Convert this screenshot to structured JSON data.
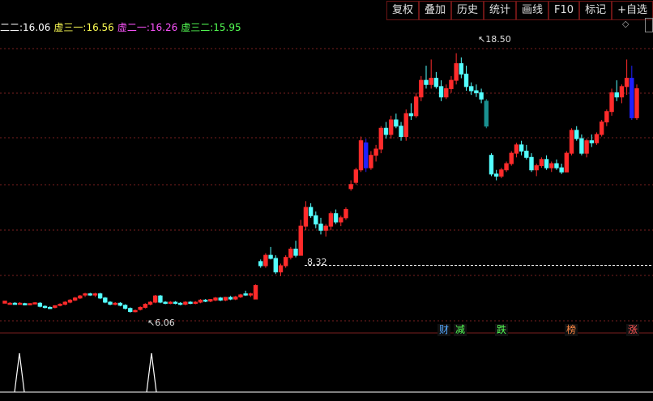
{
  "toolbar": {
    "buttons": [
      "复权",
      "叠加",
      "历史",
      "统计",
      "画线",
      "F10",
      "标记",
      "+自选"
    ]
  },
  "legend": {
    "items": [
      {
        "label": "二二:",
        "value": "16.06",
        "color": "#ffffff"
      },
      {
        "label": "虚三一:",
        "value": "16.56",
        "color": "#ffff54"
      },
      {
        "label": "虚二一:",
        "value": "16.26",
        "color": "#ff54ff"
      },
      {
        "label": "虚三二:",
        "value": "15.95",
        "color": "#54ff54"
      }
    ]
  },
  "icons": {
    "diamond": "diamond-icon"
  },
  "annotations": {
    "high": "18.50",
    "low": "6.06",
    "mid": "8.32"
  },
  "badges": [
    {
      "text": "财",
      "color": "#54a8ff"
    },
    {
      "text": "减",
      "color": "#54ff54"
    },
    {
      "text": "跌",
      "color": "#54ff54"
    },
    {
      "text": "榜",
      "color": "#ff8844"
    },
    {
      "text": "涨",
      "color": "#ff5454"
    }
  ],
  "chart_data": {
    "type": "candlestick",
    "colors": {
      "up": "#ff2b2b",
      "down": "#54ffff",
      "grid": "#7a1f1f",
      "blue": "#2020ff",
      "teal": "#1a9090"
    },
    "candles": [
      [
        6.5,
        6.6,
        6.5,
        6.6
      ],
      [
        6.5,
        6.55,
        6.45,
        6.5
      ],
      [
        6.5,
        6.55,
        6.45,
        6.48
      ],
      [
        6.5,
        6.55,
        6.45,
        6.5
      ],
      [
        6.48,
        6.52,
        6.4,
        6.45
      ],
      [
        6.45,
        6.5,
        6.4,
        6.48
      ],
      [
        6.5,
        6.55,
        6.45,
        6.52
      ],
      [
        6.5,
        6.55,
        6.3,
        6.35
      ],
      [
        6.35,
        6.4,
        6.25,
        6.3
      ],
      [
        6.3,
        6.35,
        6.25,
        6.28
      ],
      [
        6.3,
        6.4,
        6.25,
        6.38
      ],
      [
        6.4,
        6.5,
        6.35,
        6.45
      ],
      [
        6.45,
        6.6,
        6.4,
        6.55
      ],
      [
        6.55,
        6.7,
        6.5,
        6.65
      ],
      [
        6.65,
        6.8,
        6.6,
        6.75
      ],
      [
        6.75,
        6.9,
        6.7,
        6.85
      ],
      [
        6.9,
        7.0,
        6.8,
        6.95
      ],
      [
        6.95,
        7.0,
        6.85,
        6.9
      ],
      [
        6.9,
        7.0,
        6.8,
        6.95
      ],
      [
        6.95,
        7.0,
        6.7,
        6.75
      ],
      [
        6.75,
        6.8,
        6.5,
        6.55
      ],
      [
        6.55,
        6.6,
        6.4,
        6.45
      ],
      [
        6.45,
        6.55,
        6.4,
        6.5
      ],
      [
        6.5,
        6.55,
        6.35,
        6.4
      ],
      [
        6.4,
        6.45,
        6.2,
        6.25
      ],
      [
        6.25,
        6.3,
        6.05,
        6.1
      ],
      [
        6.1,
        6.2,
        6.06,
        6.15
      ],
      [
        6.2,
        6.35,
        6.15,
        6.3
      ],
      [
        6.3,
        6.5,
        6.25,
        6.45
      ],
      [
        6.45,
        6.6,
        6.4,
        6.55
      ],
      [
        6.55,
        6.9,
        6.5,
        6.85
      ],
      [
        6.85,
        6.9,
        6.5,
        6.55
      ],
      [
        6.55,
        6.6,
        6.45,
        6.5
      ],
      [
        6.5,
        6.6,
        6.45,
        6.55
      ],
      [
        6.55,
        6.6,
        6.45,
        6.5
      ],
      [
        6.5,
        6.55,
        6.4,
        6.45
      ],
      [
        6.45,
        6.6,
        6.4,
        6.55
      ],
      [
        6.55,
        6.6,
        6.45,
        6.5
      ],
      [
        6.5,
        6.6,
        6.45,
        6.55
      ],
      [
        6.55,
        6.7,
        6.5,
        6.65
      ],
      [
        6.65,
        6.7,
        6.55,
        6.6
      ],
      [
        6.6,
        6.7,
        6.55,
        6.68
      ],
      [
        6.65,
        6.8,
        6.6,
        6.75
      ],
      [
        6.75,
        6.8,
        6.6,
        6.65
      ],
      [
        6.65,
        6.8,
        6.6,
        6.78
      ],
      [
        6.78,
        6.85,
        6.65,
        6.7
      ],
      [
        6.7,
        6.85,
        6.65,
        6.8
      ],
      [
        6.8,
        6.95,
        6.75,
        6.9
      ],
      [
        6.95,
        7.1,
        6.85,
        6.9
      ],
      [
        6.9,
        7.0,
        6.8,
        6.95
      ],
      [
        6.7,
        7.4,
        6.7,
        7.35
      ],
      [
        8.5,
        8.6,
        8.2,
        8.3
      ],
      [
        8.3,
        8.9,
        8.2,
        8.8
      ],
      [
        8.8,
        9.2,
        8.6,
        8.65
      ],
      [
        8.65,
        8.8,
        7.9,
        8.0
      ],
      [
        8.0,
        8.4,
        7.8,
        8.3
      ],
      [
        8.3,
        8.8,
        8.2,
        8.7
      ],
      [
        8.7,
        9.2,
        8.6,
        9.1
      ],
      [
        9.1,
        9.5,
        8.7,
        8.8
      ],
      [
        8.8,
        10.5,
        8.8,
        10.2
      ],
      [
        10.2,
        11.4,
        10.0,
        11.1
      ],
      [
        11.1,
        11.3,
        10.6,
        10.7
      ],
      [
        10.7,
        10.9,
        10.1,
        10.3
      ],
      [
        10.3,
        10.6,
        9.8,
        10.0
      ],
      [
        10.0,
        10.3,
        9.7,
        10.2
      ],
      [
        10.2,
        10.9,
        10.0,
        10.8
      ],
      [
        10.8,
        11.0,
        10.3,
        10.4
      ],
      [
        10.4,
        10.7,
        10.2,
        10.6
      ],
      [
        10.6,
        11.1,
        10.5,
        11.0
      ],
      [
        12.0,
        12.4,
        11.9,
        12.2
      ],
      [
        12.3,
        13.0,
        12.2,
        12.9
      ],
      [
        12.9,
        14.5,
        12.8,
        14.3
      ],
      [
        14.2,
        14.4,
        12.8,
        13.0
      ],
      [
        13.0,
        13.8,
        12.9,
        13.6
      ],
      [
        13.6,
        14.1,
        13.3,
        13.9
      ],
      [
        13.9,
        15.0,
        13.7,
        14.9
      ],
      [
        14.9,
        15.2,
        14.4,
        14.6
      ],
      [
        14.6,
        15.5,
        14.4,
        15.3
      ],
      [
        15.3,
        15.6,
        14.9,
        15.0
      ],
      [
        15.0,
        15.2,
        14.3,
        14.5
      ],
      [
        14.5,
        15.8,
        14.3,
        15.6
      ],
      [
        15.6,
        16.1,
        15.3,
        15.5
      ],
      [
        15.5,
        16.6,
        15.4,
        16.4
      ],
      [
        16.4,
        17.4,
        16.2,
        17.2
      ],
      [
        17.2,
        17.9,
        16.8,
        17.0
      ],
      [
        17.0,
        18.2,
        16.8,
        17.3
      ],
      [
        17.3,
        17.6,
        16.8,
        16.9
      ],
      [
        16.9,
        17.2,
        16.2,
        16.4
      ],
      [
        16.4,
        17.0,
        16.3,
        16.8
      ],
      [
        16.8,
        17.4,
        16.6,
        17.2
      ],
      [
        17.2,
        18.5,
        17.0,
        18.0
      ],
      [
        18.0,
        18.3,
        17.3,
        17.5
      ],
      [
        17.5,
        17.9,
        16.7,
        16.9
      ],
      [
        16.9,
        17.1,
        16.5,
        16.7
      ],
      [
        16.7,
        17.0,
        16.4,
        16.6
      ],
      [
        16.6,
        16.8,
        16.1,
        16.3
      ],
      [
        16.2,
        16.3,
        14.9,
        15.0
      ],
      [
        13.6,
        13.7,
        12.6,
        12.7
      ],
      [
        12.7,
        12.9,
        12.4,
        12.6
      ],
      [
        12.6,
        13.0,
        12.5,
        12.9
      ],
      [
        12.9,
        13.3,
        12.8,
        13.2
      ],
      [
        13.2,
        13.8,
        13.1,
        13.7
      ],
      [
        13.7,
        14.2,
        13.5,
        14.1
      ],
      [
        14.1,
        14.3,
        13.6,
        13.8
      ],
      [
        13.8,
        14.1,
        13.4,
        13.5
      ],
      [
        13.5,
        13.7,
        12.8,
        12.9
      ],
      [
        12.9,
        13.2,
        12.6,
        13.1
      ],
      [
        13.1,
        13.5,
        13.0,
        13.4
      ],
      [
        13.4,
        13.6,
        12.9,
        13.0
      ],
      [
        13.0,
        13.3,
        12.8,
        13.2
      ],
      [
        13.2,
        13.4,
        12.9,
        13.0
      ],
      [
        13.0,
        13.2,
        12.7,
        12.8
      ],
      [
        12.8,
        13.8,
        12.8,
        13.7
      ],
      [
        13.7,
        14.9,
        13.6,
        14.8
      ],
      [
        14.8,
        15.0,
        14.3,
        14.4
      ],
      [
        14.4,
        14.6,
        13.6,
        13.7
      ],
      [
        13.7,
        14.4,
        13.5,
        14.3
      ],
      [
        14.3,
        14.6,
        14.0,
        14.2
      ],
      [
        14.2,
        14.7,
        14.1,
        14.6
      ],
      [
        14.6,
        15.3,
        14.5,
        15.2
      ],
      [
        15.2,
        15.8,
        15.0,
        15.7
      ],
      [
        15.7,
        16.8,
        15.5,
        16.6
      ],
      [
        16.6,
        17.2,
        16.2,
        16.4
      ],
      [
        16.4,
        17.0,
        16.1,
        16.9
      ],
      [
        16.9,
        18.2,
        16.5,
        17.3
      ],
      [
        17.3,
        17.9,
        15.3,
        15.4
      ],
      [
        15.4,
        17.0,
        15.3,
        16.8
      ]
    ],
    "reference_line": 8.32,
    "ylim": [
      5.5,
      19.5
    ],
    "indicator_spikes": [
      24,
      187
    ]
  }
}
